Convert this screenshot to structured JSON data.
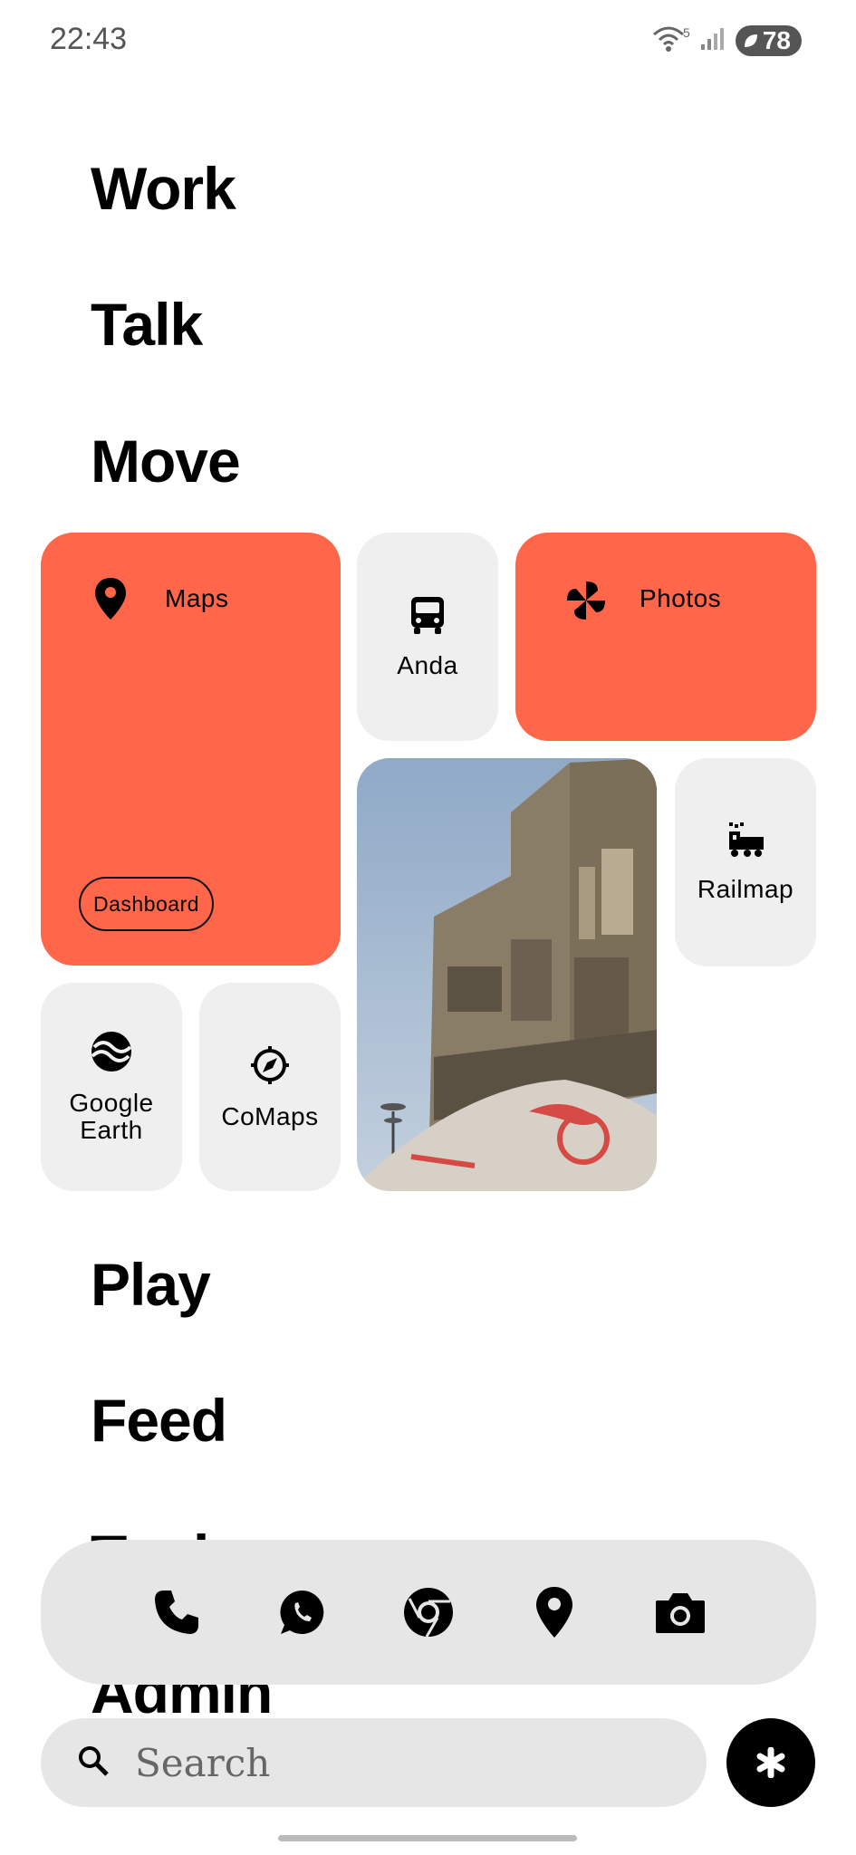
{
  "status_bar": {
    "time": "22:43",
    "wifi_badge": "5",
    "battery": "78"
  },
  "categories": {
    "work": "Work",
    "talk": "Talk",
    "move": "Move",
    "play": "Play",
    "feed": "Feed",
    "tools": "Tools",
    "admin": "Admin"
  },
  "move_tiles": {
    "maps": {
      "label": "Maps",
      "icon": "map-pin-icon",
      "chip": "Dashboard"
    },
    "anda": {
      "label": "Anda",
      "icon": "bus-icon"
    },
    "photos": {
      "label": "Photos",
      "icon": "pinwheel-icon"
    },
    "railmap": {
      "label": "Railmap",
      "icon": "train-icon"
    },
    "google_earth": {
      "label": "Google Earth",
      "icon": "earth-waves-icon"
    },
    "comaps": {
      "label": "CoMaps",
      "icon": "compass-icon"
    },
    "photo_widget": {
      "icon": "building-photo"
    }
  },
  "dock": [
    "phone-icon",
    "whatsapp-icon",
    "chrome-icon",
    "map-pin-icon",
    "camera-icon"
  ],
  "search": {
    "placeholder": "Search"
  },
  "colors": {
    "accent": "#ff664a",
    "tile_gray": "#efefef",
    "dock_gray": "#e6e6e6"
  }
}
